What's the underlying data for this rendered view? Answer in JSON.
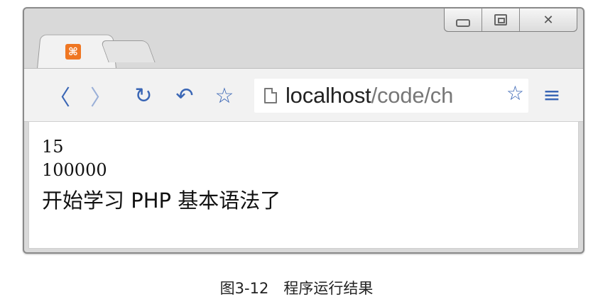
{
  "window": {
    "controls": {
      "minimize": "",
      "maximize": "",
      "close": "✕"
    }
  },
  "tab": {
    "favicon_glyph": "⌘",
    "favicon_color": "#ef7622"
  },
  "toolbar": {
    "back_icon": "〈",
    "forward_icon": "〉",
    "reload_icon": "↻",
    "undo_icon": "↶",
    "bookmark_icon": "☆",
    "menu_icon": "≡"
  },
  "address_bar": {
    "host": "localhost",
    "path": "/code/ch",
    "star_icon": "☆"
  },
  "page": {
    "lines": [
      "15",
      "100000",
      "开始学习 PHP 基本语法了"
    ]
  },
  "caption": "图3-12　程序运行结果",
  "colors": {
    "accent": "#3a66b5",
    "frame": "#d9d9d9"
  }
}
